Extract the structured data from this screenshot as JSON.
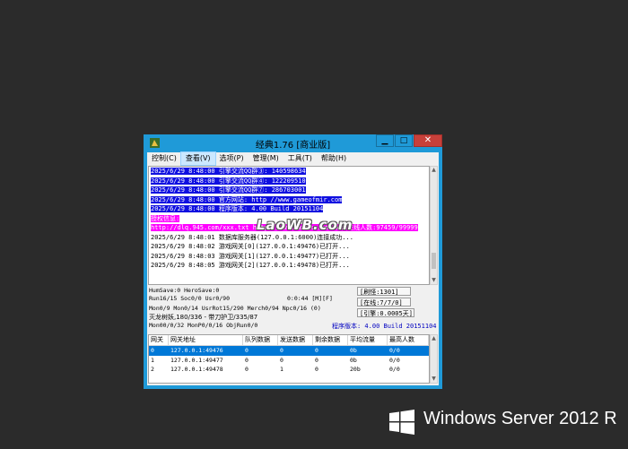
{
  "window": {
    "title": "经典1.76 [商业版]",
    "controls": {
      "minimize": "▁",
      "maximize": "□",
      "close": "✕"
    }
  },
  "menu": [
    {
      "label": "控制(C)"
    },
    {
      "label": "查看(V)",
      "active": true
    },
    {
      "label": "选项(P)"
    },
    {
      "label": "管理(M)"
    },
    {
      "label": "工具(T)"
    },
    {
      "label": "帮助(H)"
    }
  ],
  "log": [
    {
      "text": "2025/6/29 8:48:00 引擎交流QQ群③: 140598634",
      "style": "hl"
    },
    {
      "text": "2025/6/29 8:48:00 引擎交流QQ群④: 122209510",
      "style": "hl"
    },
    {
      "text": "2025/6/29 8:48:00 引擎交流QQ群⑦: 286703001",
      "style": "hl"
    },
    {
      "text": "2025/6/29 8:48:00 官方网站: http //www.gameofmir.com",
      "style": "hl"
    },
    {
      "text": "2025/6/29 8:48:00 程序版本: 4.00 Build 20151104",
      "style": "hl"
    },
    {
      "text": "授权信息:",
      "style": "mg"
    },
    {
      "text": "http://dlq.945.com/xxx.txt http://www.lxxxxx.com/xx 在线人数:97459/99999",
      "style": "mg"
    },
    {
      "text": "2025/6/29 8:48:01 数据库服务器(127.0.0.1:6000)连接成功...",
      "style": ""
    },
    {
      "text": "2025/6/29 8:48:02 游戏网关[0](127.0.0.1:49476)已打开...",
      "style": ""
    },
    {
      "text": "2025/6/29 8:48:03 游戏网关[1](127.0.0.1:49477)已打开...",
      "style": ""
    },
    {
      "text": "2025/6/29 8:48:05 游戏网关[2](127.0.0.1:49478)已打开...",
      "style": ""
    }
  ],
  "watermark": "LaoWB.com",
  "stats": {
    "line1": "HumSave:0 HeroSave:0",
    "line2": "Run16/15 Soc0/0 Usr0/90",
    "timer": "0:0:44 [M][F]",
    "line3": "Mon0/9 Mon0/14 UsrRot15/290 Merch0/94 Npc0/16 (0)",
    "line4": "灭龙树妖,180/336 - 带刀护卫/335/87",
    "line5": "Mon00/0/32 MonP0/0/16 ObjRun0/0",
    "refresh": "[刷怪:1301]",
    "online": "[在线:7/7/0]",
    "engine": "[引擎:0.0005天]",
    "version": "程序版本: 4.00 Build 20151104"
  },
  "table": {
    "columns": [
      "网关",
      "网关地址",
      "队列数据",
      "发送数据",
      "剩余数据",
      "平均流量",
      "最高人数"
    ],
    "rows": [
      [
        "0",
        "127.0.0.1:49476",
        "0",
        "0",
        "0",
        "0b",
        "0/0"
      ],
      [
        "1",
        "127.0.0.1:49477",
        "0",
        "0",
        "0",
        "0b",
        "0/0"
      ],
      [
        "2",
        "127.0.0.1:49478",
        "0",
        "1",
        "0",
        "20b",
        "0/0"
      ]
    ]
  },
  "desktop": {
    "brand": "Windows Server 2012 R"
  },
  "colors": {
    "titlebar": "#1f9ad8",
    "highlight_blue": "#1010e0",
    "highlight_magenta": "#ff00ff",
    "selected_row": "#0078d7"
  }
}
